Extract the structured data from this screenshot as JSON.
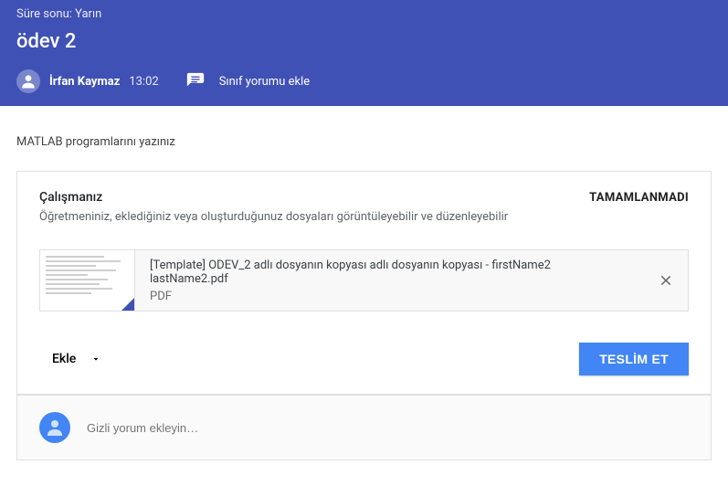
{
  "header": {
    "due": "Süre sonu: Yarın",
    "title": "ödev 2",
    "author": "İrfan Kaymaz",
    "time": "13:02",
    "class_comment": "Sınıf yorumu ekle"
  },
  "description": "MATLAB programlarını yazınız",
  "work": {
    "title": "Çalışmanız",
    "status": "TAMAMLANMADI",
    "teacher_note": "Öğretmeniniz, eklediğiniz veya oluşturduğunuz dosyaları görüntüleyebilir ve düzenleyebilir"
  },
  "attachment": {
    "name": "[Template] ODEV_2 adlı dosyanın kopyası adlı dosyanın kopyası - firstName2 lastName2.pdf",
    "type": "PDF"
  },
  "actions": {
    "add": "Ekle",
    "submit": "TESLİM ET"
  },
  "private_comment_placeholder": "Gizli yorum ekleyin…"
}
